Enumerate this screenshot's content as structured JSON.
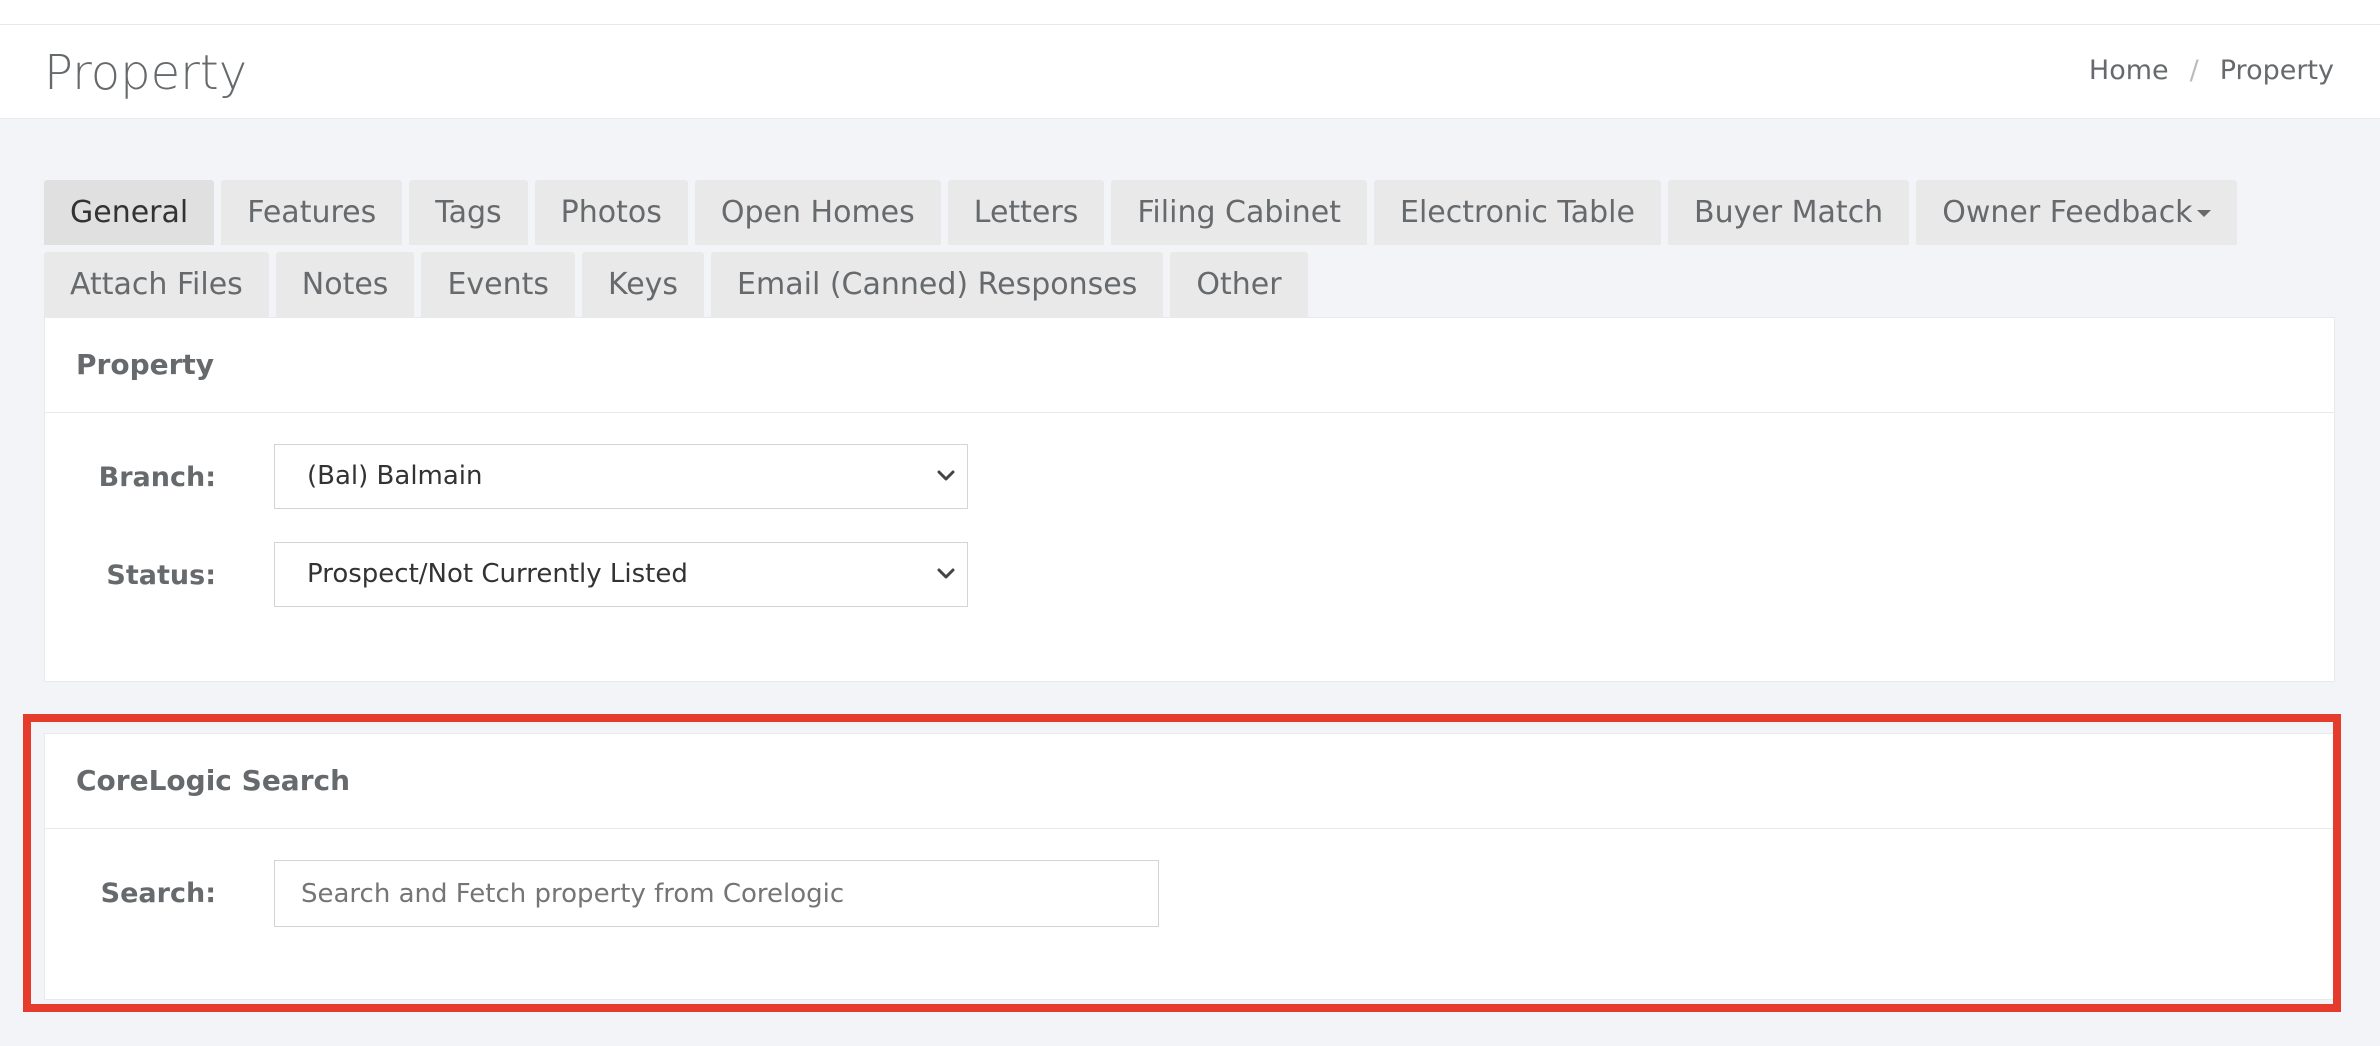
{
  "header": {
    "title": "Property",
    "breadcrumb": {
      "home": "Home",
      "separator": "/",
      "current": "Property"
    }
  },
  "tabs": [
    {
      "label": "General",
      "active": true
    },
    {
      "label": "Features"
    },
    {
      "label": "Tags"
    },
    {
      "label": "Photos"
    },
    {
      "label": "Open Homes"
    },
    {
      "label": "Letters"
    },
    {
      "label": "Filing Cabinet"
    },
    {
      "label": "Electronic Table"
    },
    {
      "label": "Buyer Match"
    },
    {
      "label": "Owner Feedback",
      "dropdown": true
    },
    {
      "label": "Attach Files"
    },
    {
      "label": "Notes"
    },
    {
      "label": "Events"
    },
    {
      "label": "Keys"
    },
    {
      "label": "Email (Canned) Responses"
    },
    {
      "label": "Other"
    }
  ],
  "property_panel": {
    "title": "Property",
    "branch": {
      "label": "Branch:",
      "value": "(Bal) Balmain"
    },
    "status": {
      "label": "Status:",
      "value": "Prospect/Not Currently Listed"
    }
  },
  "corelogic_panel": {
    "title": "CoreLogic Search",
    "search": {
      "label": "Search:",
      "placeholder": "Search and Fetch property from Corelogic"
    }
  },
  "colors": {
    "highlight": "#e53b2c",
    "background": "#f3f4f7",
    "tab_bg": "#e9e9ea"
  }
}
